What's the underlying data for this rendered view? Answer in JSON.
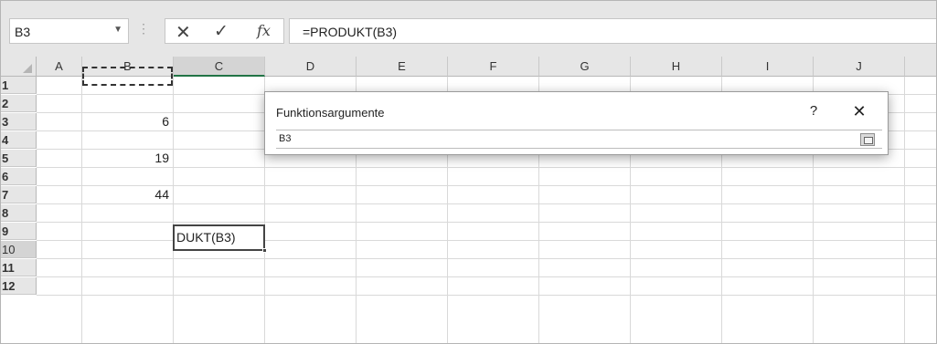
{
  "formula_bar": {
    "name_box": "B3",
    "name_box_dropdown": "▼",
    "separator": "⋮",
    "cancel_icon": "✕",
    "enter_icon": "✓",
    "fx_icon": "fx",
    "formula": "=PRODUKT(B3)"
  },
  "columns": [
    "A",
    "B",
    "C",
    "D",
    "E",
    "F",
    "G",
    "H",
    "I",
    "J"
  ],
  "rows": [
    "1",
    "2",
    "3",
    "4",
    "5",
    "6",
    "7",
    "8",
    "9",
    "10",
    "11",
    "12"
  ],
  "cells": {
    "b3": "6",
    "b5": "19",
    "b7": "44",
    "c10": "DUKT(B3)"
  },
  "dialog": {
    "title": "Funktionsargumente",
    "help": "?",
    "close": "✕",
    "input_value": "B3"
  },
  "colors": {
    "selected_header_underline": "#217346",
    "header_bg": "#e6e6e6"
  }
}
